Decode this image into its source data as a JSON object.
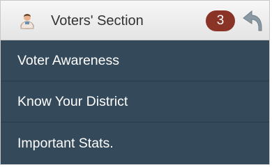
{
  "header": {
    "icon": "user-avatar-icon",
    "title": "Voters' Section",
    "badge_count": "3",
    "back_icon": "curved-up-arrow-icon"
  },
  "menu": {
    "items": [
      {
        "label": "Voter Awareness"
      },
      {
        "label": "Know Your District"
      },
      {
        "label": "Important Stats."
      }
    ]
  },
  "colors": {
    "menu_bg": "#34495a",
    "badge_bg": "#8a3327",
    "header_bg": "#ececec"
  }
}
